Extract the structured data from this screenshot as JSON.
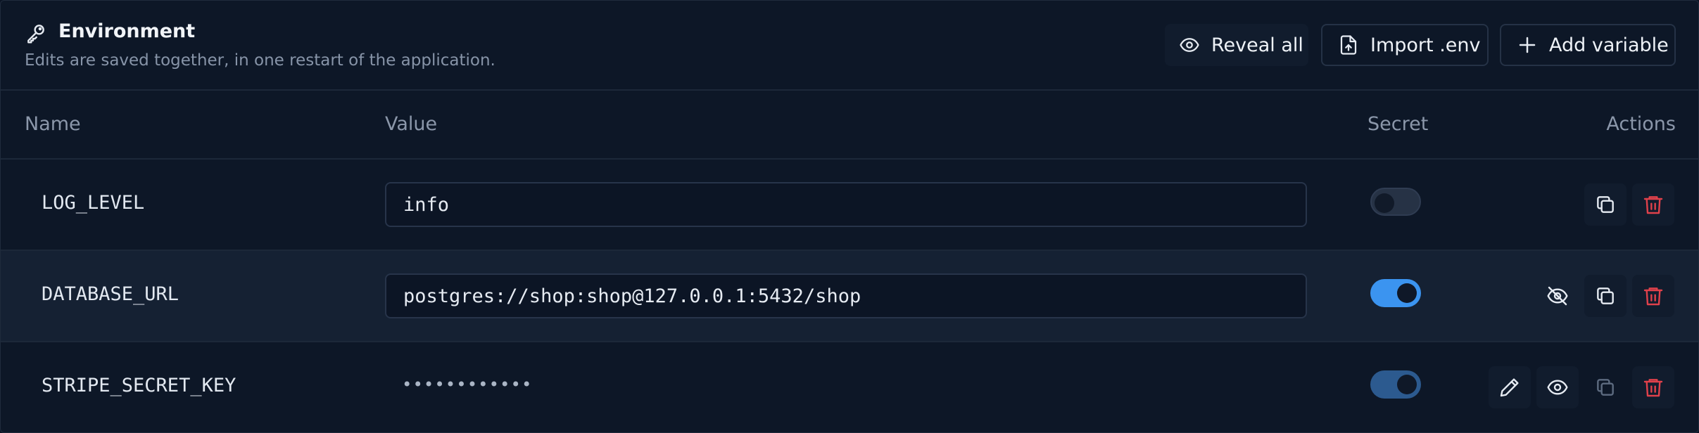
{
  "header": {
    "title": "Environment",
    "subtitle": "Edits are saved together, in one restart of the application.",
    "buttons": {
      "reveal_all": "Reveal all",
      "import_env": "Import .env",
      "add_variable": "Add variable"
    }
  },
  "table": {
    "columns": {
      "name": "Name",
      "value": "Value",
      "secret": "Secret",
      "actions": "Actions"
    },
    "rows": [
      {
        "name": "LOG_LEVEL",
        "value": "info",
        "secret": false
      },
      {
        "name": "DATABASE_URL",
        "value": "postgres://shop:shop@127.0.0.1:5432/shop",
        "secret": true,
        "revealed": true
      },
      {
        "name": "STRIPE_SECRET_KEY",
        "value": "••••••••••••",
        "secret": true,
        "revealed": false
      }
    ]
  },
  "icons": {
    "title": "key-icon",
    "reveal_all": "eye-icon",
    "import_env": "file-upload-icon",
    "add_variable": "plus-icon",
    "hide": "eye-off-icon",
    "reveal": "eye-icon",
    "edit": "pencil-icon",
    "copy": "copy-icon",
    "delete": "trash-icon"
  },
  "colors": {
    "background": "#0d1727",
    "accent": "#3b94f0",
    "danger": "#e0414b",
    "muted_text": "#8794a8"
  }
}
